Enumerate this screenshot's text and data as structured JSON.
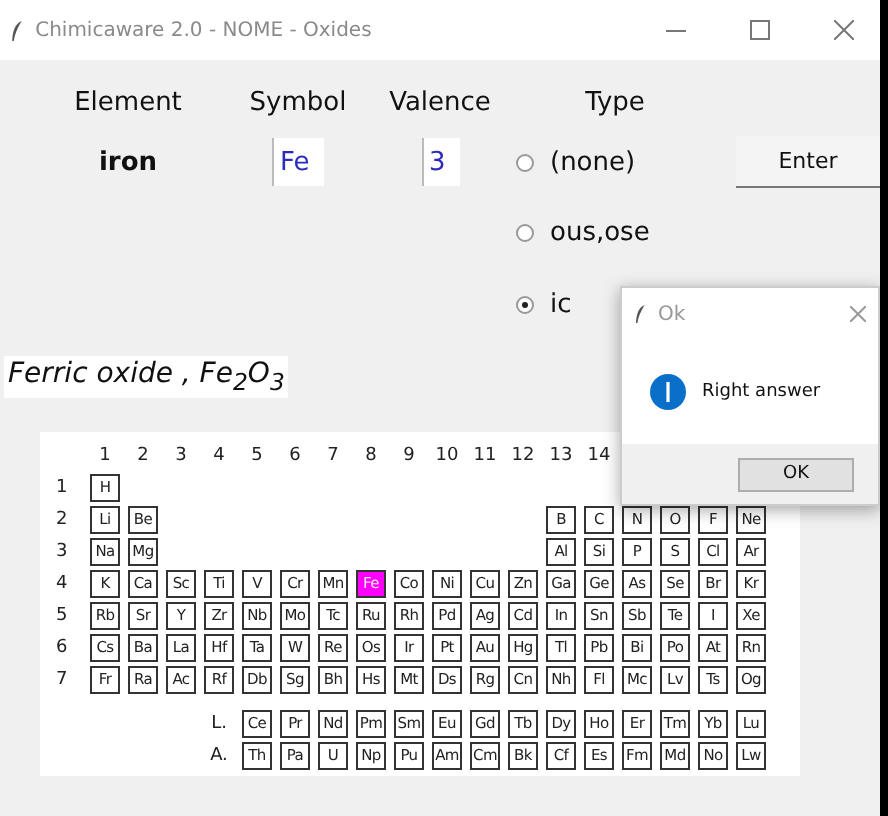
{
  "window": {
    "title": "Chimicaware 2.0 - NOME - Oxides"
  },
  "form": {
    "headers": [
      "Element",
      "Symbol",
      "Valence",
      "Type"
    ],
    "element": "iron",
    "symbol": {
      "value": "Fe"
    },
    "valence": {
      "value": "3"
    },
    "type_options": [
      {
        "label": "(none)",
        "selected": false
      },
      {
        "label": "ous,ose",
        "selected": false
      },
      {
        "label": "ic",
        "selected": true
      }
    ],
    "enter_button": "Enter"
  },
  "result": "Ferric oxide , Fe$_{2}$O$_{3}$",
  "periodic_table": {
    "groups": [
      "1",
      "2",
      "3",
      "4",
      "5",
      "6",
      "7",
      "8",
      "9",
      "10",
      "11",
      "12",
      "13",
      "14"
    ],
    "periods": [
      {
        "label": "1",
        "elements": [
          {
            "symbol": "H",
            "selected": false
          }
        ]
      },
      {
        "label": "2",
        "elements": [
          {
            "symbol": "Li",
            "selected": false
          },
          {
            "symbol": "Be",
            "selected": false
          }
        ],
        "right_elements": [
          {
            "symbol": "B",
            "selected": false
          },
          {
            "symbol": "C",
            "selected": false
          },
          {
            "symbol": "N",
            "selected": false
          },
          {
            "symbol": "O",
            "selected": false
          },
          {
            "symbol": "F",
            "selected": false
          },
          {
            "symbol": "Ne",
            "selected": false
          }
        ]
      },
      {
        "label": "3",
        "elements": [
          {
            "symbol": "Na",
            "selected": false
          },
          {
            "symbol": "Mg",
            "selected": false
          }
        ],
        "right_elements": [
          {
            "symbol": "Al",
            "selected": false
          },
          {
            "symbol": "Si",
            "selected": false
          },
          {
            "symbol": "P",
            "selected": false
          },
          {
            "symbol": "S",
            "selected": false
          },
          {
            "symbol": "Cl",
            "selected": false
          },
          {
            "symbol": "Ar",
            "selected": false
          }
        ]
      },
      {
        "label": "4",
        "elements": [
          {
            "symbol": "K",
            "selected": false
          },
          {
            "symbol": "Ca",
            "selected": false
          },
          {
            "symbol": "Sc",
            "selected": false
          },
          {
            "symbol": "Ti",
            "selected": false
          },
          {
            "symbol": "V",
            "selected": false
          },
          {
            "symbol": "Cr",
            "selected": false
          },
          {
            "symbol": "Mn",
            "selected": false
          },
          {
            "symbol": "Fe",
            "selected": true
          },
          {
            "symbol": "Co",
            "selected": false
          },
          {
            "symbol": "Ni",
            "selected": false
          },
          {
            "symbol": "Cu",
            "selected": false
          },
          {
            "symbol": "Zn",
            "selected": false
          },
          {
            "symbol": "Ga",
            "selected": false
          },
          {
            "symbol": "Ge",
            "selected": false
          },
          {
            "symbol": "As",
            "selected": false
          },
          {
            "symbol": "Se",
            "selected": false
          },
          {
            "symbol": "Br",
            "selected": false
          },
          {
            "symbol": "Kr",
            "selected": false
          }
        ]
      },
      {
        "label": "5",
        "elements": [
          {
            "symbol": "Rb",
            "selected": false
          },
          {
            "symbol": "Sr",
            "selected": false
          },
          {
            "symbol": "Y",
            "selected": false
          },
          {
            "symbol": "Zr",
            "selected": false
          },
          {
            "symbol": "Nb",
            "selected": false
          },
          {
            "symbol": "Mo",
            "selected": false
          },
          {
            "symbol": "Tc",
            "selected": false
          },
          {
            "symbol": "Ru",
            "selected": false
          },
          {
            "symbol": "Rh",
            "selected": false
          },
          {
            "symbol": "Pd",
            "selected": false
          },
          {
            "symbol": "Ag",
            "selected": false
          },
          {
            "symbol": "Cd",
            "selected": false
          },
          {
            "symbol": "In",
            "selected": false
          },
          {
            "symbol": "Sn",
            "selected": false
          },
          {
            "symbol": "Sb",
            "selected": false
          },
          {
            "symbol": "Te",
            "selected": false
          },
          {
            "symbol": "I",
            "selected": false
          },
          {
            "symbol": "Xe",
            "selected": false
          }
        ]
      },
      {
        "label": "6",
        "elements": [
          {
            "symbol": "Cs",
            "selected": false
          },
          {
            "symbol": "Ba",
            "selected": false
          },
          {
            "symbol": "La",
            "selected": false
          },
          {
            "symbol": "Hf",
            "selected": false
          },
          {
            "symbol": "Ta",
            "selected": false
          },
          {
            "symbol": "W",
            "selected": false
          },
          {
            "symbol": "Re",
            "selected": false
          },
          {
            "symbol": "Os",
            "selected": false
          },
          {
            "symbol": "Ir",
            "selected": false
          },
          {
            "symbol": "Pt",
            "selected": false
          },
          {
            "symbol": "Au",
            "selected": false
          },
          {
            "symbol": "Hg",
            "selected": false
          },
          {
            "symbol": "Tl",
            "selected": false
          },
          {
            "symbol": "Pb",
            "selected": false
          },
          {
            "symbol": "Bi",
            "selected": false
          },
          {
            "symbol": "Po",
            "selected": false
          },
          {
            "symbol": "At",
            "selected": false
          },
          {
            "symbol": "Rn",
            "selected": false
          }
        ]
      },
      {
        "label": "7",
        "elements": [
          {
            "symbol": "Fr",
            "selected": false
          },
          {
            "symbol": "Ra",
            "selected": false
          },
          {
            "symbol": "Ac",
            "selected": false
          },
          {
            "symbol": "Rf",
            "selected": false
          },
          {
            "symbol": "Db",
            "selected": false
          },
          {
            "symbol": "Sg",
            "selected": false
          },
          {
            "symbol": "Bh",
            "selected": false
          },
          {
            "symbol": "Hs",
            "selected": false
          },
          {
            "symbol": "Mt",
            "selected": false
          },
          {
            "symbol": "Ds",
            "selected": false
          },
          {
            "symbol": "Rg",
            "selected": false
          },
          {
            "symbol": "Cn",
            "selected": false
          },
          {
            "symbol": "Nh",
            "selected": false
          },
          {
            "symbol": "Fl",
            "selected": false
          },
          {
            "symbol": "Mc",
            "selected": false
          },
          {
            "symbol": "Lv",
            "selected": false
          },
          {
            "symbol": "Ts",
            "selected": false
          },
          {
            "symbol": "Og",
            "selected": false
          }
        ]
      }
    ],
    "series": [
      {
        "label": "L.",
        "elements": [
          {
            "symbol": "Ce",
            "selected": false
          },
          {
            "symbol": "Pr",
            "selected": false
          },
          {
            "symbol": "Nd",
            "selected": false
          },
          {
            "symbol": "Pm",
            "selected": false
          },
          {
            "symbol": "Sm",
            "selected": false
          },
          {
            "symbol": "Eu",
            "selected": false
          },
          {
            "symbol": "Gd",
            "selected": false
          },
          {
            "symbol": "Tb",
            "selected": false
          },
          {
            "symbol": "Dy",
            "selected": false
          },
          {
            "symbol": "Ho",
            "selected": false
          },
          {
            "symbol": "Er",
            "selected": false
          },
          {
            "symbol": "Tm",
            "selected": false
          },
          {
            "symbol": "Yb",
            "selected": false
          },
          {
            "symbol": "Lu",
            "selected": false
          }
        ]
      },
      {
        "label": "A.",
        "elements": [
          {
            "symbol": "Th",
            "selected": false
          },
          {
            "symbol": "Pa",
            "selected": false
          },
          {
            "symbol": "U",
            "selected": false
          },
          {
            "symbol": "Np",
            "selected": false
          },
          {
            "symbol": "Pu",
            "selected": false
          },
          {
            "symbol": "Am",
            "selected": false
          },
          {
            "symbol": "Cm",
            "selected": false
          },
          {
            "symbol": "Bk",
            "selected": false
          },
          {
            "symbol": "Cf",
            "selected": false
          },
          {
            "symbol": "Es",
            "selected": false
          },
          {
            "symbol": "Fm",
            "selected": false
          },
          {
            "symbol": "Md",
            "selected": false
          },
          {
            "symbol": "No",
            "selected": false
          },
          {
            "symbol": "Lw",
            "selected": false
          }
        ]
      }
    ]
  },
  "dialog": {
    "title": "Ok",
    "message": "Right answer",
    "button": "OK"
  }
}
